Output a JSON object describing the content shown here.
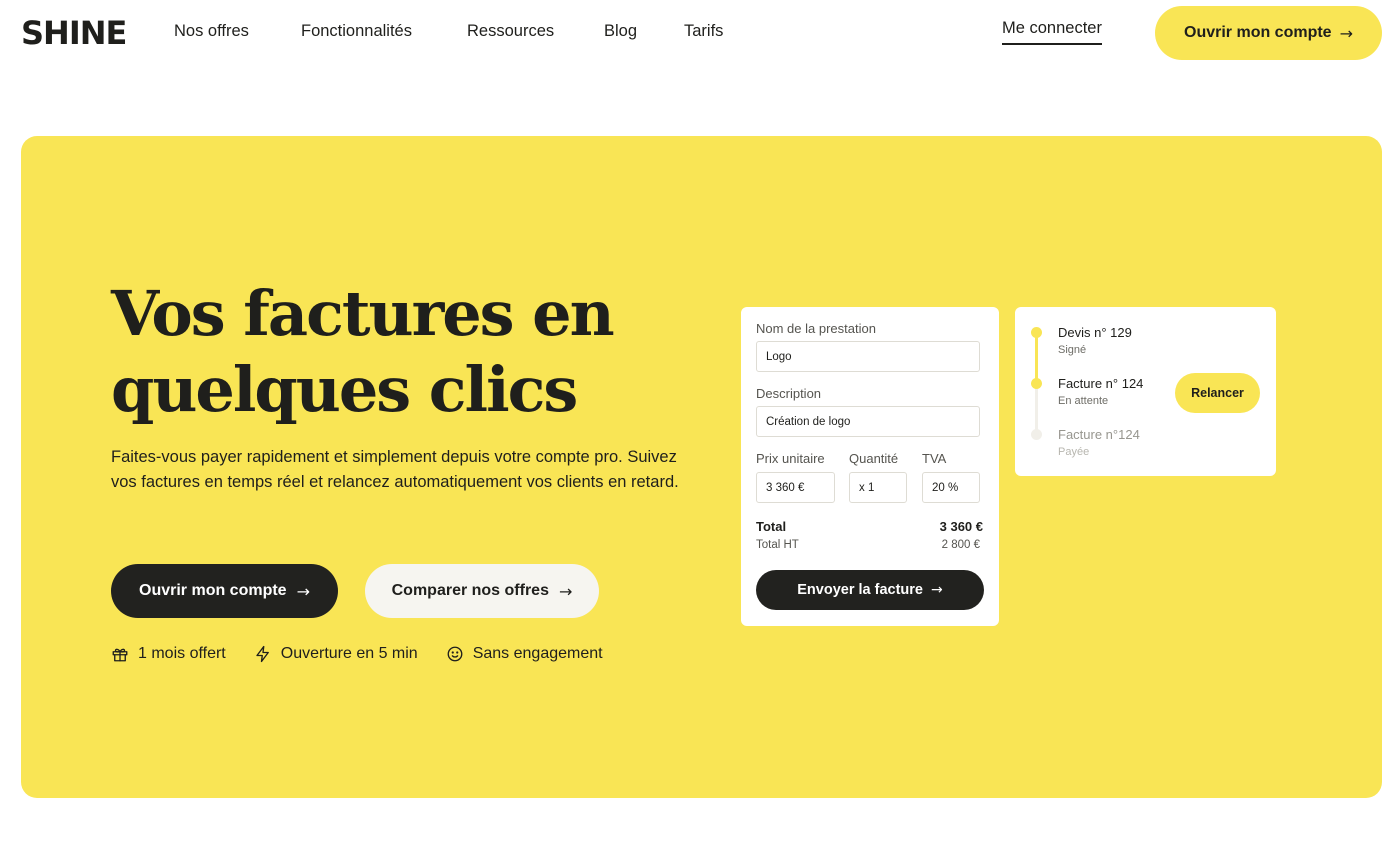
{
  "header": {
    "logo": "SHINE",
    "nav": [
      "Nos offres",
      "Fonctionnalités",
      "Ressources",
      "Blog",
      "Tarifs"
    ],
    "login": "Me connecter",
    "cta": "Ouvrir mon compte"
  },
  "hero": {
    "title_line1": "Vos factures en",
    "title_line2": "quelques clics",
    "subtitle": "Faites-vous payer rapidement et simplement depuis votre compte pro. Suivez vos factures en temps réel et relancez automatiquement vos clients en retard.",
    "primary_cta": "Ouvrir mon compte",
    "secondary_cta": "Comparer nos offres",
    "perks": [
      "1 mois offert",
      "Ouverture en 5 min",
      "Sans engagement"
    ]
  },
  "invoice": {
    "name_label": "Nom de la prestation",
    "name_value": "Logo",
    "description_label": "Description",
    "description_value": "Création de logo",
    "price_label": "Prix unitaire",
    "price_value": "3 360 €",
    "quantity_label": "Quantité",
    "quantity_value": "x 1",
    "vat_label": "TVA",
    "vat_value": "20 %",
    "total_label": "Total",
    "total_value": "3 360 €",
    "total_ht_label": "Total HT",
    "total_ht_value": "2 800 €",
    "send_button": "Envoyer la facture"
  },
  "status": {
    "items": [
      {
        "title": "Devis n° 129",
        "state": "Signé"
      },
      {
        "title": "Facture n° 124",
        "state": "En attente"
      },
      {
        "title": "Facture n°124",
        "state": "Payée"
      }
    ],
    "remind_button": "Relancer"
  },
  "colors": {
    "brand_yellow": "#f9e555",
    "dark": "#22221f",
    "light_button": "#f6f5f0"
  }
}
